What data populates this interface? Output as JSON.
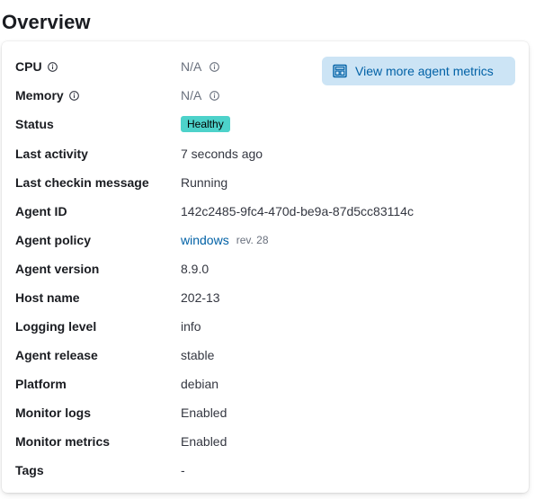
{
  "page": {
    "title": "Overview"
  },
  "metrics_button": {
    "label": "View more agent metrics",
    "icon": "dashboard-app-icon"
  },
  "rows": {
    "cpu": {
      "label": "CPU",
      "value": "N/A"
    },
    "memory": {
      "label": "Memory",
      "value": "N/A"
    },
    "status": {
      "label": "Status",
      "value": "Healthy",
      "badge_color": "#4dd2ca"
    },
    "last_activity": {
      "label": "Last activity",
      "value": "7 seconds ago"
    },
    "last_checkin_message": {
      "label": "Last checkin message",
      "value": "Running"
    },
    "agent_id": {
      "label": "Agent ID",
      "value": "142c2485-9fc4-470d-be9a-87d5cc83114c"
    },
    "agent_policy": {
      "label": "Agent policy",
      "value": "windows",
      "revision": "rev. 28"
    },
    "agent_version": {
      "label": "Agent version",
      "value": "8.9.0"
    },
    "host_name": {
      "label": "Host name",
      "value": "202-13"
    },
    "logging_level": {
      "label": "Logging level",
      "value": "info"
    },
    "agent_release": {
      "label": "Agent release",
      "value": "stable"
    },
    "platform": {
      "label": "Platform",
      "value": "debian"
    },
    "monitor_logs": {
      "label": "Monitor logs",
      "value": "Enabled"
    },
    "monitor_metrics": {
      "label": "Monitor metrics",
      "value": "Enabled"
    },
    "tags": {
      "label": "Tags",
      "value": "-"
    }
  },
  "colors": {
    "link": "#0061a6",
    "button_bg": "#cce4f5",
    "text": "#1a1c21"
  }
}
